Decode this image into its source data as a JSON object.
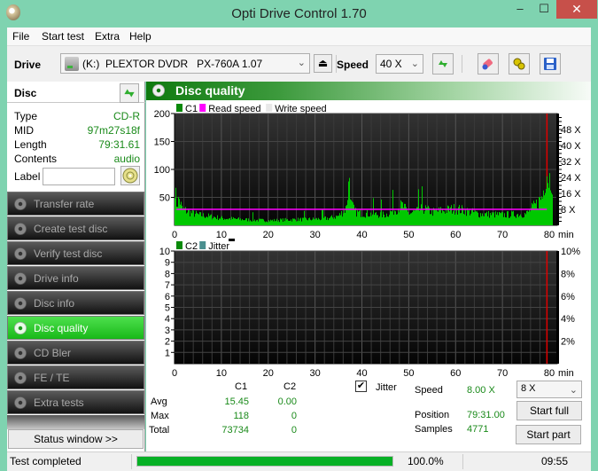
{
  "window": {
    "title": "Opti Drive Control 1.70",
    "minimize": "‒",
    "maximize": "☐",
    "close": "✕"
  },
  "menu": [
    "File",
    "Start test",
    "Extra",
    "Help"
  ],
  "toolbar": {
    "drive_label": "Drive",
    "drive_value": "(K:)  PLEXTOR DVDR   PX-760A 1.07",
    "speed_label": "Speed",
    "speed_value": "40 X",
    "icons": [
      "refresh-icon",
      "eraser-icon",
      "settings-icon",
      "save-icon"
    ]
  },
  "disc": {
    "header": "Disc",
    "rows": [
      {
        "key": "Type",
        "value": "CD-R"
      },
      {
        "key": "MID",
        "value": "97m27s18f"
      },
      {
        "key": "Length",
        "value": "79:31.61"
      },
      {
        "key": "Contents",
        "value": "audio"
      }
    ],
    "label_key": "Label",
    "label_value": ""
  },
  "nav": [
    {
      "label": "Transfer rate",
      "active": false
    },
    {
      "label": "Create test disc",
      "active": false
    },
    {
      "label": "Verify test disc",
      "active": false
    },
    {
      "label": "Drive info",
      "active": false
    },
    {
      "label": "Disc info",
      "active": false
    },
    {
      "label": "Disc quality",
      "active": true
    },
    {
      "label": "CD Bler",
      "active": false
    },
    {
      "label": "FE / TE",
      "active": false
    },
    {
      "label": "Extra tests",
      "active": false
    }
  ],
  "status_window_btn": "Status window >>",
  "panel_title": "Disc quality",
  "stats": {
    "col_c1": "C1",
    "col_c2": "C2",
    "avg_label": "Avg",
    "max_label": "Max",
    "total_label": "Total",
    "c1_avg": "15.45",
    "c2_avg": "0.00",
    "c1_max": "118",
    "c2_max": "0",
    "c1_total": "73734",
    "c2_total": "0",
    "jitter_label": "Jitter",
    "jitter_checked": true,
    "speed_label": "Speed",
    "speed_value": "8.00 X",
    "position_label": "Position",
    "position_value": "79:31.00",
    "samples_label": "Samples",
    "samples_value": "4771",
    "speed_select": "8 X",
    "start_full": "Start full",
    "start_part": "Start part"
  },
  "statusbar": {
    "text": "Test completed",
    "progress": 100.0,
    "progress_text": "100.0%",
    "time": "09:55"
  },
  "chart_data": [
    {
      "type": "bar",
      "title": "C1 / Read speed",
      "legend": [
        {
          "name": "C1",
          "color": "#0a8a0a"
        },
        {
          "name": "Read speed",
          "color": "#ff00ff"
        },
        {
          "name": "Write speed",
          "color": "#e8e8e8"
        }
      ],
      "legend_position": "top-left",
      "xlabel": "min",
      "xlim": [
        0,
        80
      ],
      "x_ticks": [
        "0",
        "10",
        "20",
        "30",
        "40",
        "50",
        "60",
        "70",
        "80"
      ],
      "ylim": [
        0,
        200
      ],
      "y_ticks": [
        "50",
        "100",
        "150",
        "200"
      ],
      "y2_ticks": [
        "8 X",
        "16 X",
        "24 X",
        "32 X",
        "40 X",
        "48 X"
      ],
      "y2lim": [
        0,
        56
      ],
      "grid": true,
      "end_marker_min": 79.5,
      "c1_profile": [
        {
          "x": 0,
          "y": 88
        },
        {
          "x": 0.3,
          "y": 45
        },
        {
          "x": 1,
          "y": 55
        },
        {
          "x": 1.5,
          "y": 35
        },
        {
          "x": 3,
          "y": 28
        },
        {
          "x": 5,
          "y": 22
        },
        {
          "x": 8,
          "y": 18
        },
        {
          "x": 10,
          "y": 15
        },
        {
          "x": 15,
          "y": 12
        },
        {
          "x": 20,
          "y": 10
        },
        {
          "x": 25,
          "y": 12
        },
        {
          "x": 30,
          "y": 13
        },
        {
          "x": 33,
          "y": 15
        },
        {
          "x": 35,
          "y": 20
        },
        {
          "x": 36.5,
          "y": 35
        },
        {
          "x": 37,
          "y": 75
        },
        {
          "x": 37.3,
          "y": 110
        },
        {
          "x": 37.6,
          "y": 45
        },
        {
          "x": 38.5,
          "y": 28
        },
        {
          "x": 40,
          "y": 25
        },
        {
          "x": 45,
          "y": 22
        },
        {
          "x": 48.5,
          "y": 42
        },
        {
          "x": 50,
          "y": 24
        },
        {
          "x": 53,
          "y": 35
        },
        {
          "x": 55,
          "y": 28
        },
        {
          "x": 60,
          "y": 35
        },
        {
          "x": 65,
          "y": 24
        },
        {
          "x": 70,
          "y": 22
        },
        {
          "x": 75,
          "y": 24
        },
        {
          "x": 76.5,
          "y": 38
        },
        {
          "x": 77.5,
          "y": 48
        },
        {
          "x": 78.5,
          "y": 62
        },
        {
          "x": 79,
          "y": 95
        },
        {
          "x": 79.4,
          "y": 118
        },
        {
          "x": 79.6,
          "y": 100
        }
      ],
      "read_speed_x": 8.0
    },
    {
      "type": "bar",
      "title": "C2 / Jitter",
      "legend": [
        {
          "name": "C2",
          "color": "#0a8a0a"
        },
        {
          "name": "Jitter",
          "color": "#4a8f8f"
        }
      ],
      "legend_position": "top-left",
      "xlabel": "min",
      "xlim": [
        0,
        80
      ],
      "x_ticks": [
        "0",
        "10",
        "20",
        "30",
        "40",
        "50",
        "60",
        "70",
        "80"
      ],
      "ylim": [
        0,
        10
      ],
      "y_ticks": [
        "1",
        "2",
        "3",
        "4",
        "5",
        "6",
        "7",
        "8",
        "9",
        "10"
      ],
      "y2_ticks": [
        "2%",
        "4%",
        "6%",
        "8%",
        "10%"
      ],
      "y2lim": [
        0,
        10
      ],
      "grid": true,
      "end_marker_min": 79.5,
      "c2_values": "all 0"
    }
  ]
}
